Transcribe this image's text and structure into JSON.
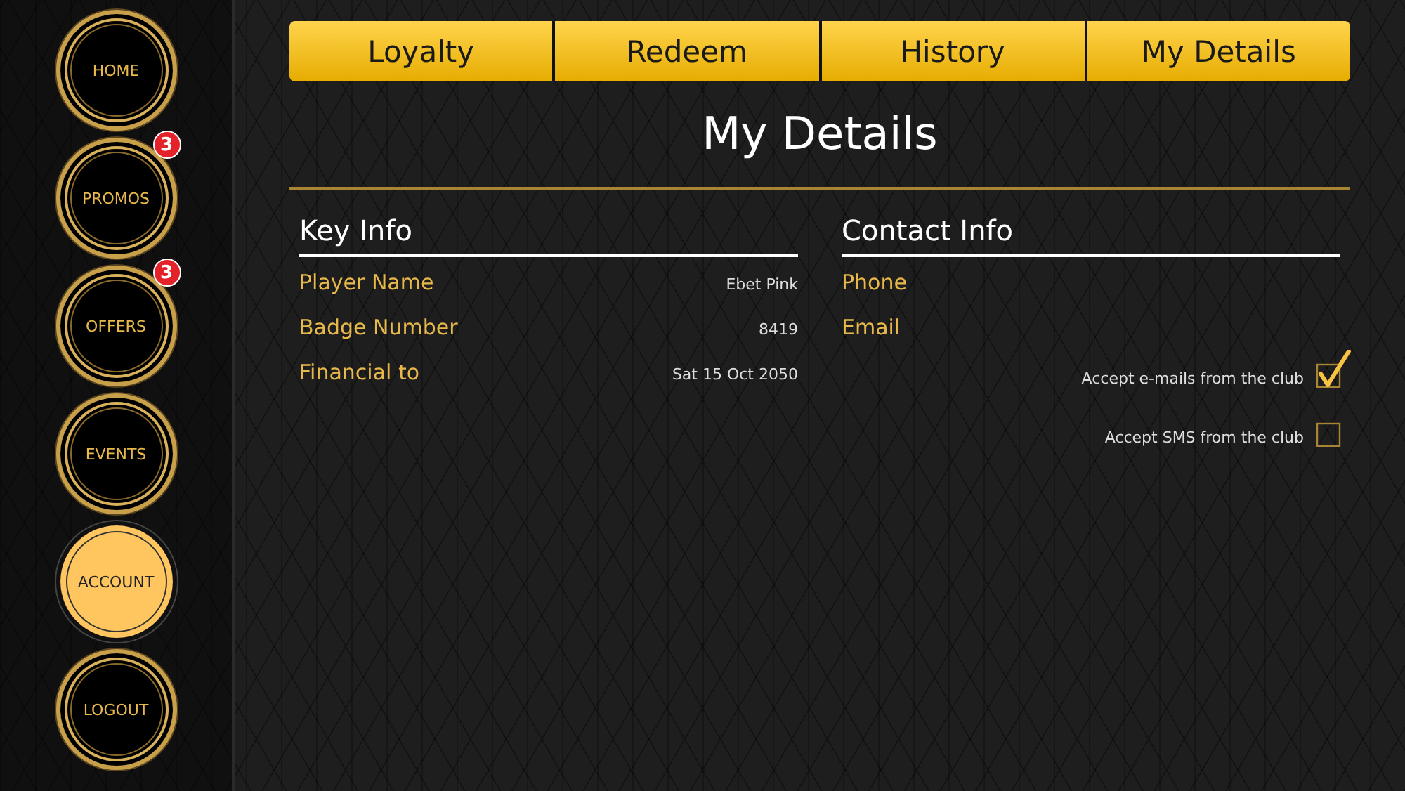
{
  "nav": [
    {
      "label": "HOME",
      "selected": false
    },
    {
      "label": "PROMOS",
      "selected": false,
      "badge": "3"
    },
    {
      "label": "OFFERS",
      "selected": false,
      "badge": "3"
    },
    {
      "label": "EVENTS",
      "selected": false
    },
    {
      "label": "ACCOUNT",
      "selected": true
    },
    {
      "label": "LOGOUT",
      "selected": false
    }
  ],
  "tabs": [
    {
      "label": "Loyalty"
    },
    {
      "label": "Redeem"
    },
    {
      "label": "History"
    },
    {
      "label": "My Details"
    }
  ],
  "page_title": "My Details",
  "key_info": {
    "heading": "Key Info",
    "rows": [
      {
        "label": "Player Name",
        "value": "Ebet Pink"
      },
      {
        "label": "Badge Number",
        "value": "8419"
      },
      {
        "label": "Financial to",
        "value": "Sat 15 Oct 2050"
      }
    ]
  },
  "contact_info": {
    "heading": "Contact Info",
    "rows": [
      {
        "label": "Phone"
      },
      {
        "label": "Email"
      }
    ],
    "options": [
      {
        "label": "Accept e-mails from the club",
        "checked": true
      },
      {
        "label": "Accept SMS from the club",
        "checked": false
      }
    ]
  }
}
